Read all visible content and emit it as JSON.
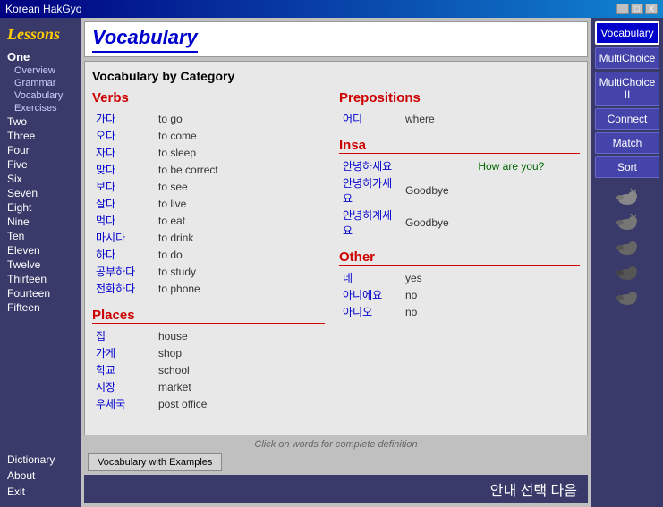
{
  "titlebar": {
    "title": "Korean HakGyo",
    "controls": [
      "_",
      "□",
      "X"
    ]
  },
  "sidebar": {
    "lessons_title": "Lessons",
    "items": [
      {
        "label": "One",
        "active": true
      },
      {
        "label": "Overview",
        "sub": true
      },
      {
        "label": "Grammar",
        "sub": true
      },
      {
        "label": "Vocabulary",
        "sub": true
      },
      {
        "label": "Exercises",
        "sub": true
      },
      {
        "label": "Two"
      },
      {
        "label": "Three"
      },
      {
        "label": "Four"
      },
      {
        "label": "Five"
      },
      {
        "label": "Six"
      },
      {
        "label": "Seven"
      },
      {
        "label": "Eight"
      },
      {
        "label": "Nine"
      },
      {
        "label": "Ten"
      },
      {
        "label": "Eleven"
      },
      {
        "label": "Twelve"
      },
      {
        "label": "Thirteen"
      },
      {
        "label": "Fourteen"
      },
      {
        "label": "Fifteen"
      }
    ],
    "bottom": [
      {
        "label": "Dictionary"
      },
      {
        "label": "About"
      },
      {
        "label": "Exit"
      }
    ]
  },
  "page": {
    "title": "Vocabulary",
    "subtitle": "Vocabulary by Category"
  },
  "nav_buttons": [
    {
      "label": "Vocabulary",
      "active": true
    },
    {
      "label": "MultiChoice"
    },
    {
      "label": "MultiChoice II"
    },
    {
      "label": "Connect"
    },
    {
      "label": "Match"
    },
    {
      "label": "Sort"
    }
  ],
  "sections": {
    "verbs": {
      "title": "Verbs",
      "items": [
        {
          "korean": "가다",
          "english": "to go"
        },
        {
          "korean": "오다",
          "english": "to come"
        },
        {
          "korean": "자다",
          "english": "to sleep"
        },
        {
          "korean": "맞다",
          "english": "to be correct"
        },
        {
          "korean": "보다",
          "english": "to see"
        },
        {
          "korean": "살다",
          "english": "to live"
        },
        {
          "korean": "먹다",
          "english": "to eat"
        },
        {
          "korean": "마시다",
          "english": "to drink"
        },
        {
          "korean": "하다",
          "english": "to do"
        },
        {
          "korean": "공부하다",
          "english": "to study"
        },
        {
          "korean": "전화하다",
          "english": "to phone"
        }
      ]
    },
    "places": {
      "title": "Places",
      "items": [
        {
          "korean": "집",
          "english": "house"
        },
        {
          "korean": "가게",
          "english": "shop"
        },
        {
          "korean": "학교",
          "english": "school"
        },
        {
          "korean": "시장",
          "english": "market"
        },
        {
          "korean": "우체국",
          "english": "post office"
        }
      ]
    },
    "prepositions": {
      "title": "Prepositions",
      "items": [
        {
          "korean": "어디",
          "english": "where"
        }
      ]
    },
    "insa": {
      "title": "Insa",
      "items": [
        {
          "korean": "안녕하세요",
          "english": "",
          "extra": "How are you?"
        },
        {
          "korean": "안녕히가세요",
          "english": "Goodbye"
        },
        {
          "korean": "안녕히계세요",
          "english": "Goodbye"
        }
      ]
    },
    "other": {
      "title": "Other",
      "items": [
        {
          "korean": "네",
          "english": "yes"
        },
        {
          "korean": "아니에요",
          "english": "no"
        },
        {
          "korean": "아니오",
          "english": "no"
        }
      ]
    }
  },
  "bottom": {
    "hint": "Click on words for complete definition",
    "examples_btn": "Vocabulary with Examples"
  },
  "korean_bar": {
    "text": "안내   선택   다음"
  }
}
